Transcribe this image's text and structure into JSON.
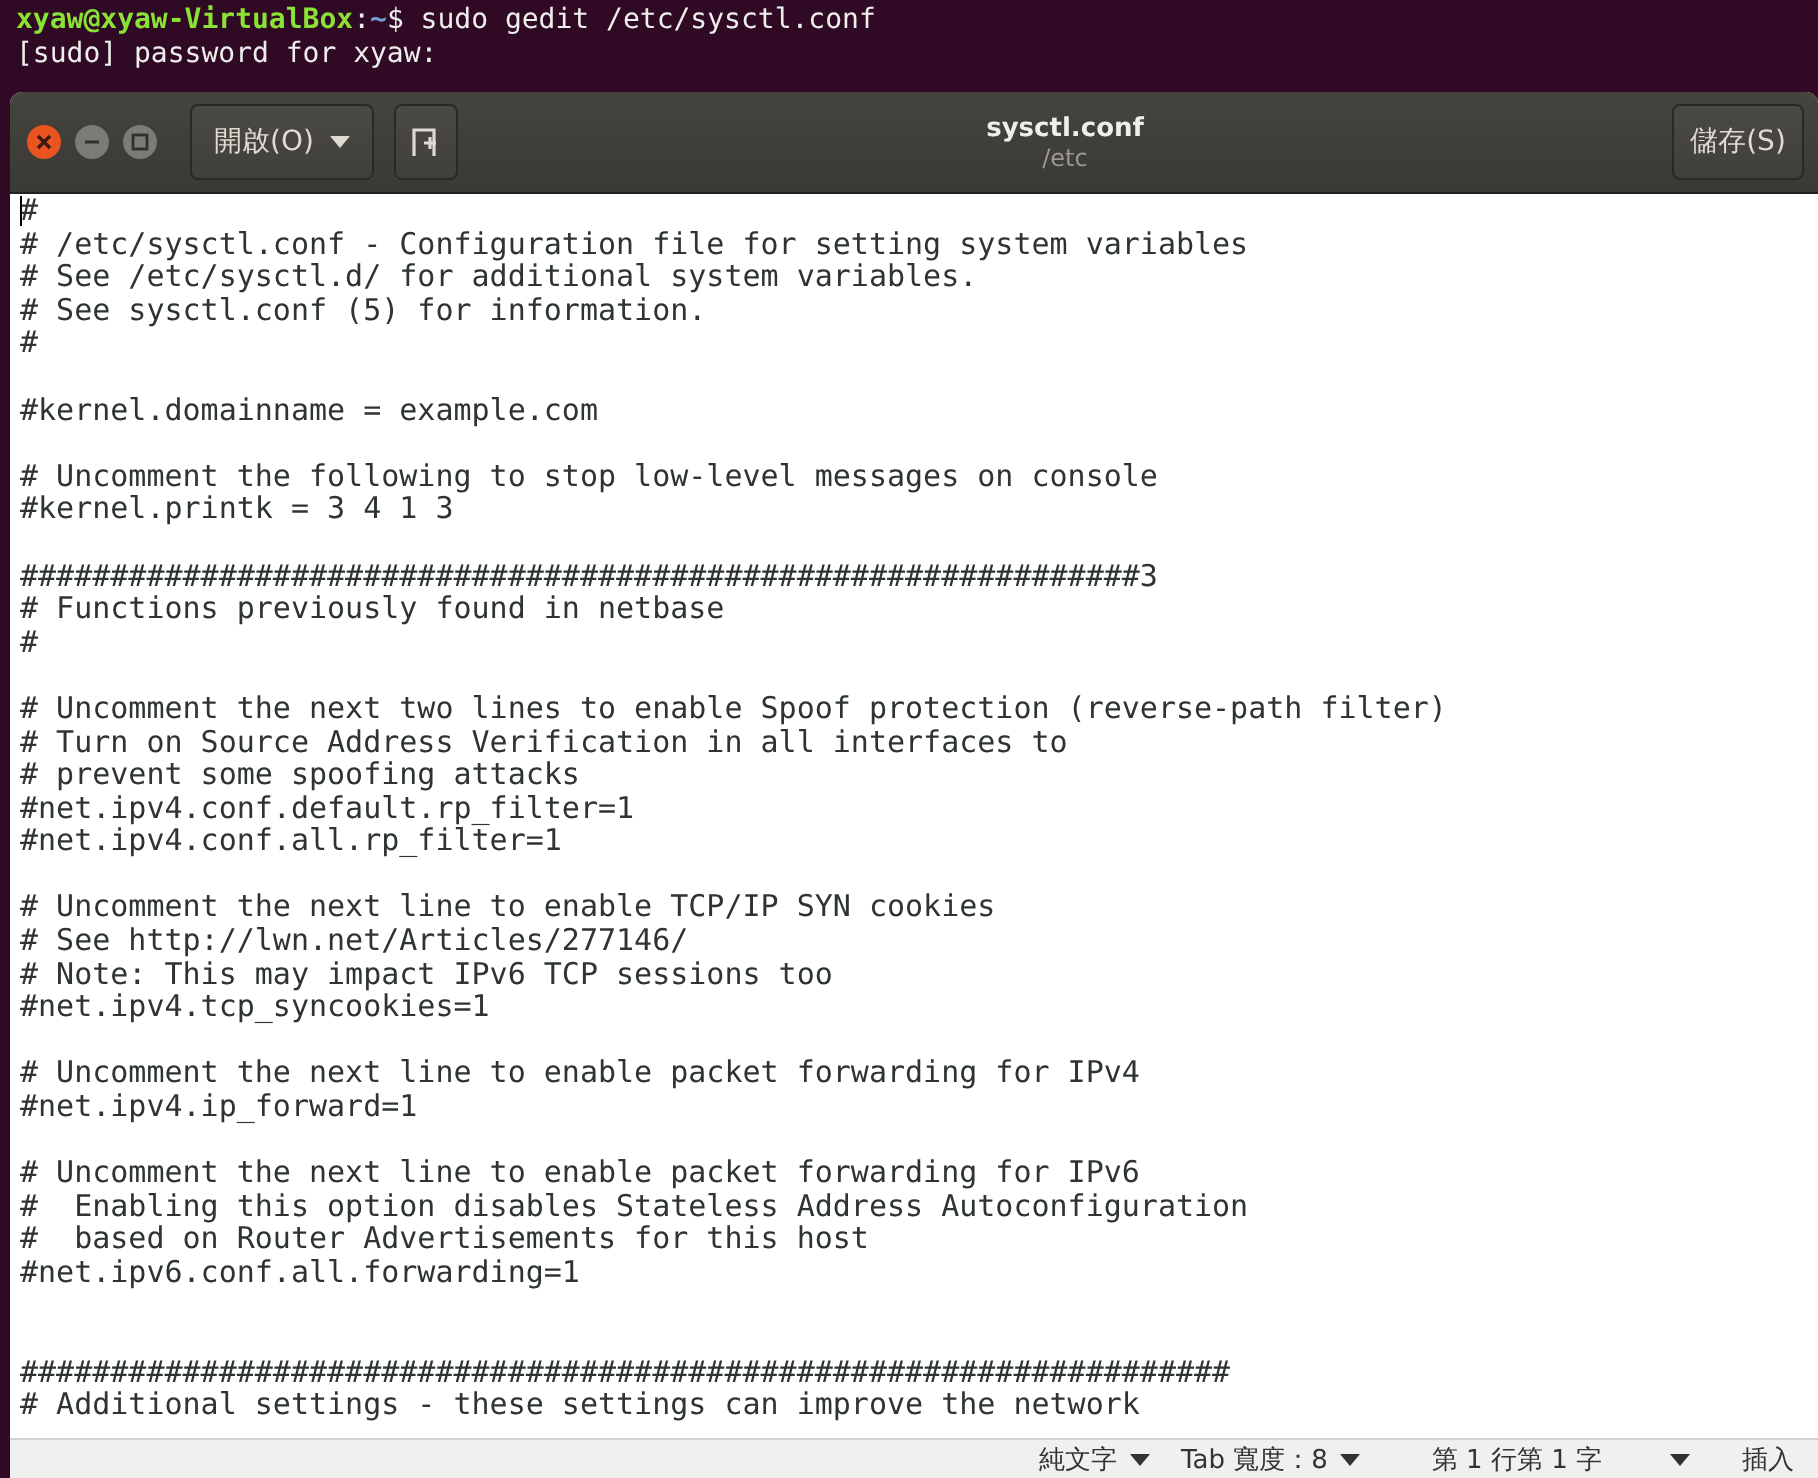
{
  "terminal": {
    "prompt": {
      "user_host": "xyaw@xyaw-VirtualBox",
      "separator": ":",
      "path": "~",
      "command": "$ sudo gedit /etc/sysctl.conf"
    },
    "output": "[sudo] password for xyaw:"
  },
  "window": {
    "title": "sysctl.conf",
    "subtitle": "/etc",
    "open_button": "開啟(O)",
    "save_button": "儲存(S)"
  },
  "editor": {
    "blocks": [
      {
        "kind": "paragraph",
        "lines": [
          "#",
          "# /etc/sysctl.conf - Configuration file for setting system variables",
          "# See /etc/sysctl.d/ for additional system variables.",
          "# See sysctl.conf (5) for information.",
          "#"
        ]
      },
      {
        "kind": "paragraph",
        "lines": [
          "#kernel.domainname = example.com"
        ]
      },
      {
        "kind": "paragraph",
        "lines": [
          "# Uncomment the following to stop low-level messages on console",
          "#kernel.printk = 3 4 1 3"
        ]
      },
      {
        "kind": "paragraph",
        "lines": [
          "##############################################################3",
          "# Functions previously found in netbase",
          "#"
        ]
      },
      {
        "kind": "paragraph",
        "lines": [
          "# Uncomment the next two lines to enable Spoof protection (reverse-path filter)",
          "# Turn on Source Address Verification in all interfaces to",
          "# prevent some spoofing attacks",
          "#net.ipv4.conf.default.rp_filter=1",
          "#net.ipv4.conf.all.rp_filter=1"
        ]
      },
      {
        "kind": "paragraph",
        "lines": [
          "# Uncomment the next line to enable TCP/IP SYN cookies",
          "# See http://lwn.net/Articles/277146/",
          "# Note: This may impact IPv6 TCP sessions too",
          "#net.ipv4.tcp_syncookies=1"
        ]
      },
      {
        "kind": "paragraph",
        "lines": [
          "# Uncomment the next line to enable packet forwarding for IPv4",
          "#net.ipv4.ip_forward=1"
        ]
      },
      {
        "kind": "paragraph",
        "lines": [
          "# Uncomment the next line to enable packet forwarding for IPv6",
          "#  Enabling this option disables Stateless Address Autoconfiguration",
          "#  based on Router Advertisements for this host",
          "#net.ipv6.conf.all.forwarding=1"
        ]
      },
      {
        "kind": "section",
        "lines": [
          "###################################################################",
          "# Additional settings - these settings can improve the network"
        ]
      }
    ]
  },
  "status_bar": {
    "language": "純文字",
    "tab_width": "Tab 寬度：8",
    "position": "第 1 行第 1 字",
    "mode": "插入"
  }
}
